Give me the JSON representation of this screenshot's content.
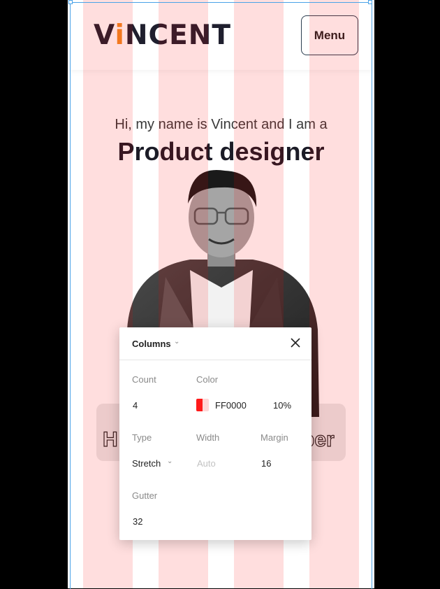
{
  "header": {
    "logo_text_a": "V",
    "logo_text_dot": "i",
    "logo_text_b": "NCENT",
    "menu_label": "Menu"
  },
  "hero": {
    "intro": "Hi, my name is Vincent and I am a",
    "role": "Product designer",
    "outline_left": "H",
    "outline_right": "ber"
  },
  "columns_panel": {
    "title": "Columns",
    "count_label": "Count",
    "count_value": "4",
    "color_label": "Color",
    "color_hex": "FF0000",
    "color_opacity": "10%",
    "type_label": "Type",
    "type_value": "Stretch",
    "width_label": "Width",
    "width_value": "Auto",
    "margin_label": "Margin",
    "margin_value": "16",
    "gutter_label": "Gutter",
    "gutter_value": "32"
  },
  "colors": {
    "grid_column": "#FF0000",
    "accent": "#f08a24",
    "frame_outline": "#4aa3e8"
  }
}
